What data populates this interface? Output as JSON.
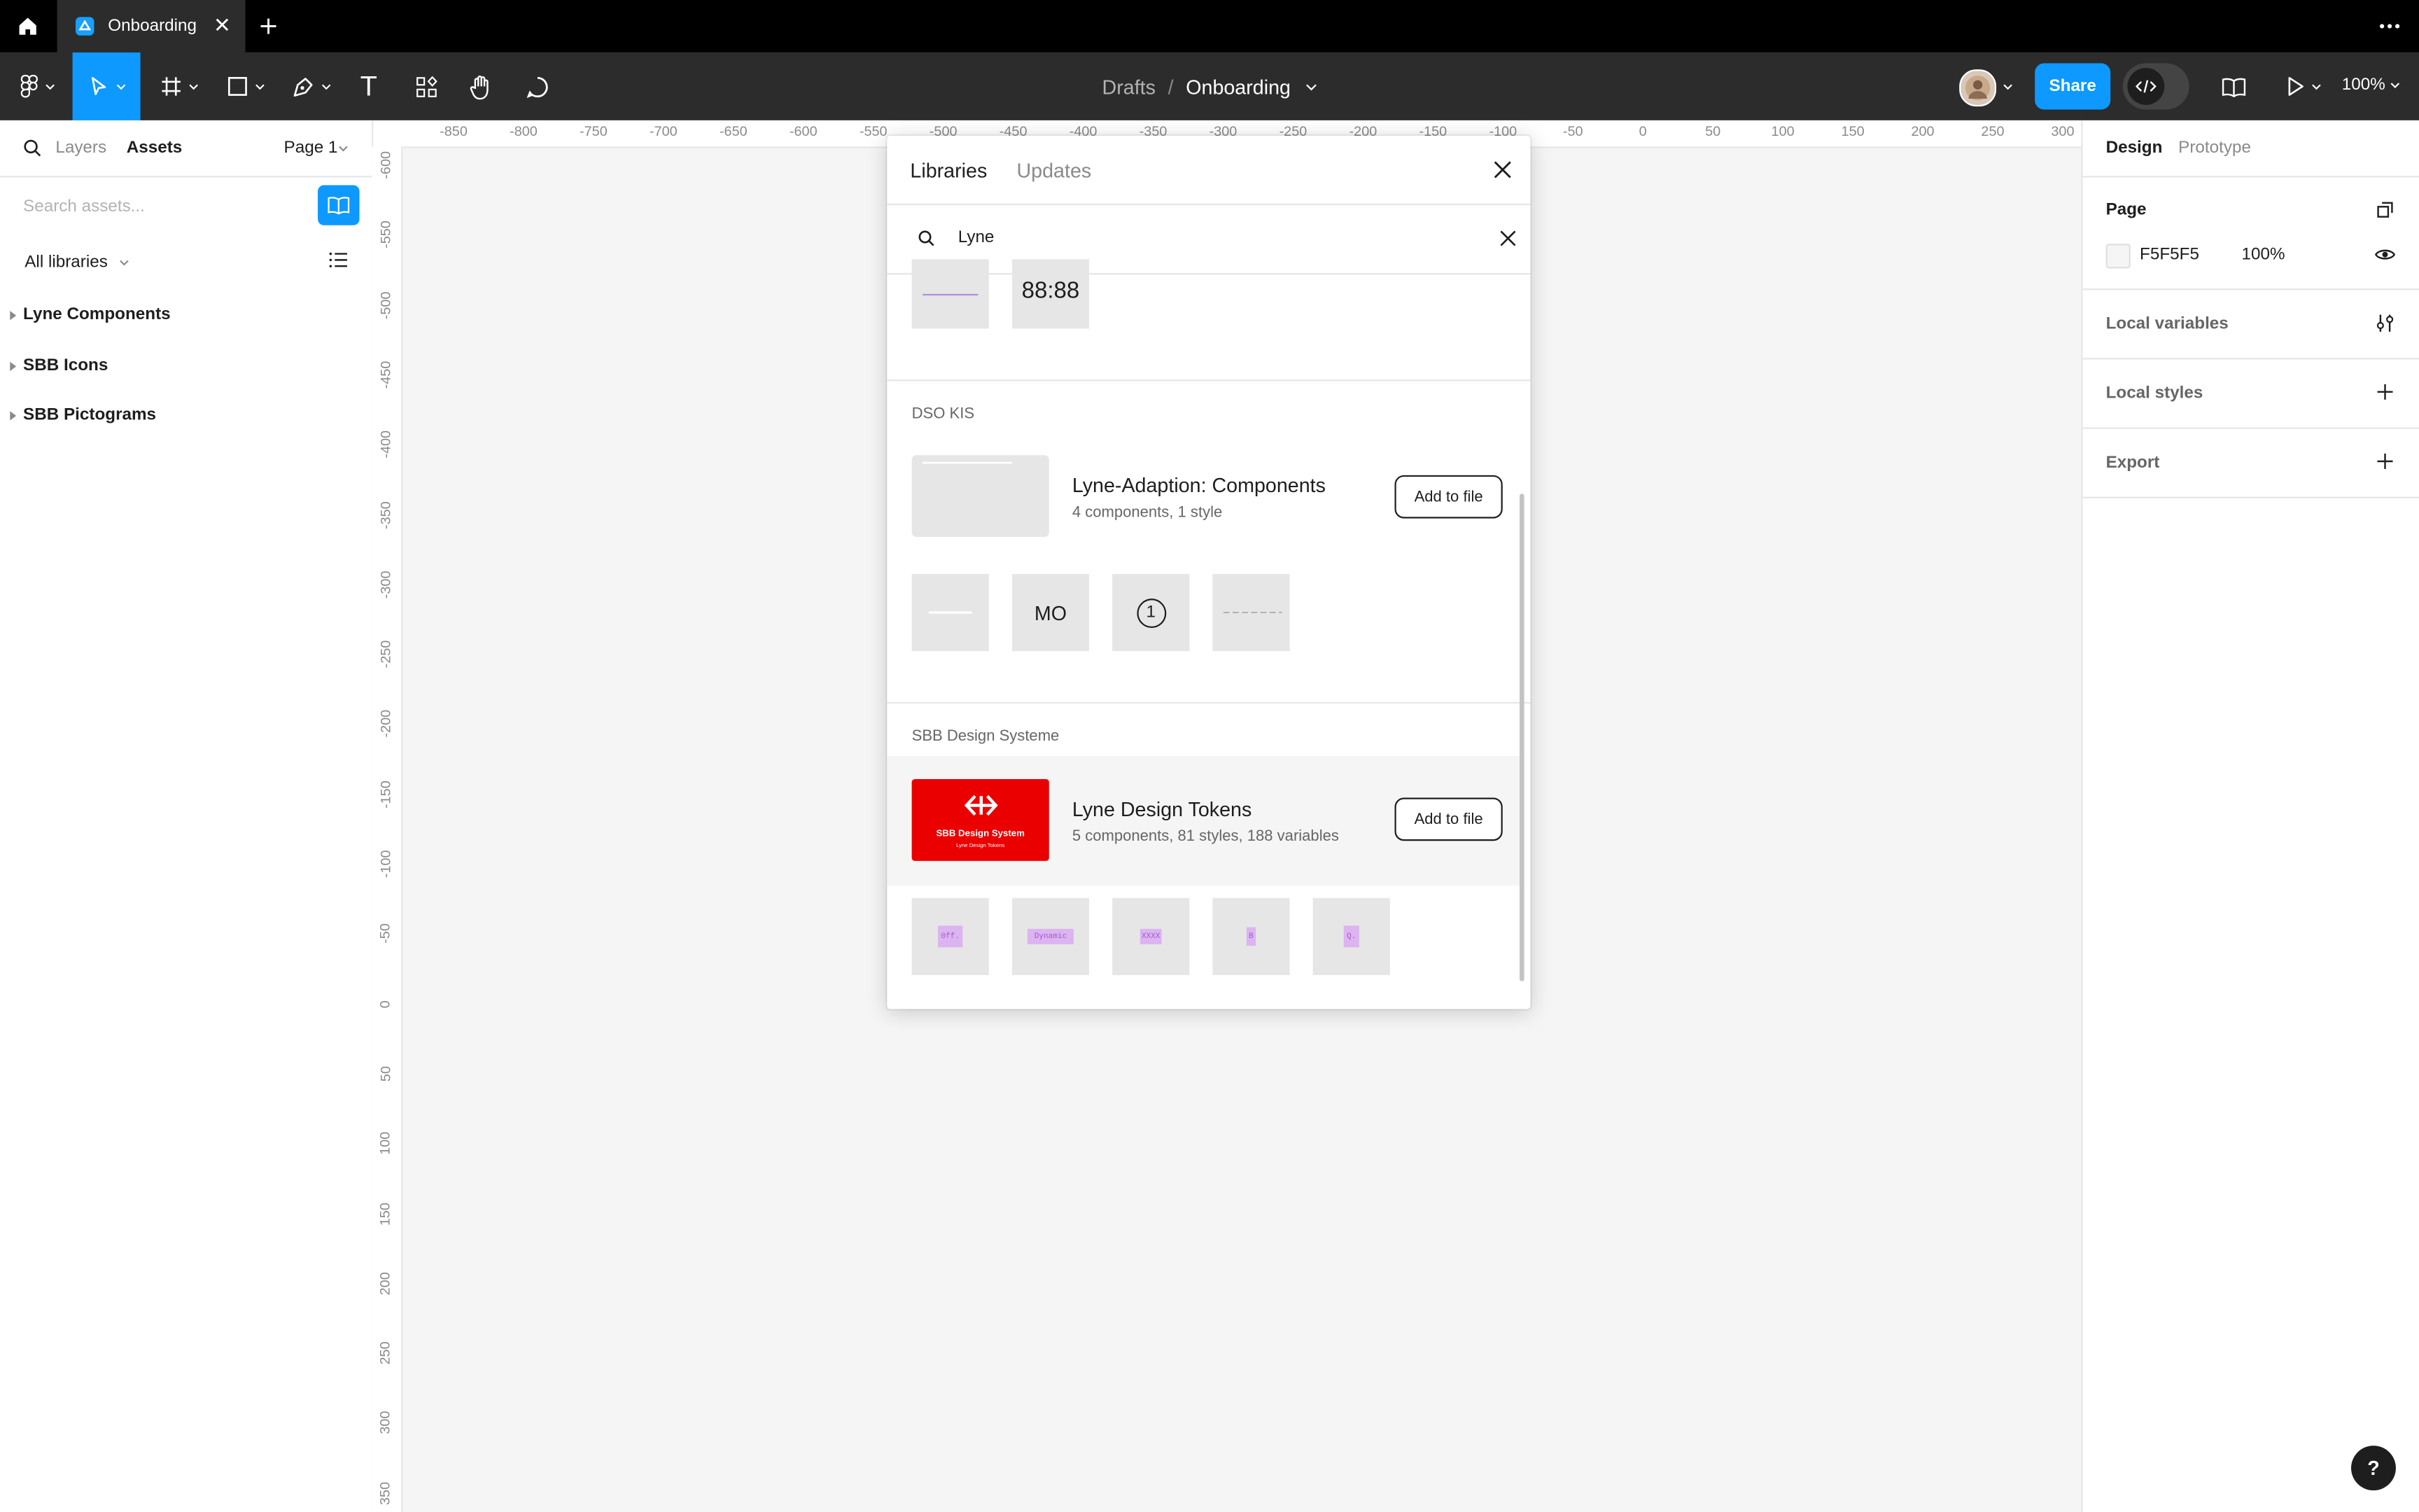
{
  "titlebar": {
    "tab_label": "Onboarding"
  },
  "toolbar": {
    "breadcrumb_parent": "Drafts",
    "breadcrumb_sep": "/",
    "breadcrumb_current": "Onboarding",
    "share_label": "Share",
    "zoom": "100%",
    "text_tool_glyph": "T"
  },
  "left_panel": {
    "tabs": [
      "Layers",
      "Assets"
    ],
    "page_select": "Page 1",
    "search_placeholder": "Search assets...",
    "filter": "All libraries",
    "libraries": [
      "Lyne Components",
      "SBB Icons",
      "SBB Pictograms"
    ]
  },
  "rulers": {
    "top": [
      "-850",
      "-800",
      "-750",
      "-700",
      "-650",
      "-600",
      "-550",
      "-500",
      "-450",
      "-400",
      "-350",
      "-300",
      "-250",
      "-200",
      "-150",
      "-100",
      "-50",
      "0",
      "50",
      "100",
      "150",
      "200",
      "250",
      "300"
    ],
    "left": [
      "-600",
      "-550",
      "-500",
      "-450",
      "-400",
      "-350",
      "-300",
      "-250",
      "-200",
      "-150",
      "-100",
      "-50",
      "0",
      "50",
      "100",
      "150",
      "200",
      "250",
      "300",
      "350"
    ]
  },
  "dialog": {
    "tabs": [
      "Libraries",
      "Updates"
    ],
    "search_value": "Lyne",
    "top_thumb_text": "88:88",
    "sections": [
      {
        "label": "DSO KIS",
        "name": "Lyne-Adaption: Components",
        "meta": "4 components, 1 style",
        "button": "Add to file",
        "thumb_texts": [
          "",
          "MO",
          "1",
          ""
        ]
      },
      {
        "label": "SBB Design Systeme",
        "name": "Lyne Design Tokens",
        "meta": "5 components, 81 styles, 188 variables",
        "button": "Add to file",
        "card_title": "SBB Design System",
        "card_sub": "Lyne Design Tokens",
        "thumb_texts": [
          "0ff.",
          "Dynamic",
          "XXXX",
          "B",
          "Q."
        ]
      }
    ]
  },
  "right_panel": {
    "tabs": [
      "Design",
      "Prototype"
    ],
    "page_title": "Page",
    "page_color": "F5F5F5",
    "page_opacity": "100%",
    "sections": [
      "Local variables",
      "Local styles",
      "Export"
    ]
  },
  "help": "?"
}
